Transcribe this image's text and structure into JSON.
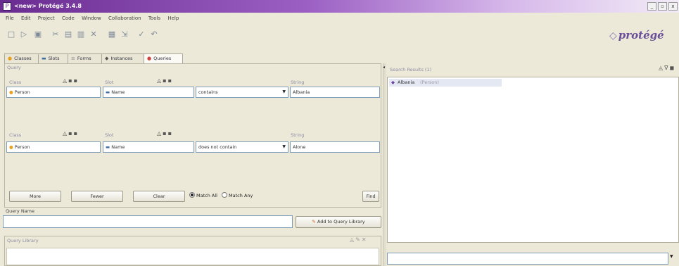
{
  "window": {
    "title": "<new> Protégé 3.4.8",
    "buttons": [
      "_",
      "▫",
      "x"
    ]
  },
  "menu": [
    "File",
    "Edit",
    "Project",
    "Code",
    "Window",
    "Collaboration",
    "Tools",
    "Help"
  ],
  "toolbar": {
    "icons": [
      "new-file-icon",
      "open-icon",
      "save-icon",
      "cut-icon",
      "copy-icon",
      "paste-icon",
      "delete-icon",
      "find-icon",
      "export-icon",
      "check-icon",
      "undo-icon"
    ]
  },
  "logo": {
    "text": "protégé"
  },
  "tabs": [
    {
      "label": "Classes",
      "icon": "●",
      "color": "#e8a020"
    },
    {
      "label": "Slots",
      "icon": "▬",
      "color": "#3a6ea5"
    },
    {
      "label": "Forms",
      "icon": "≡",
      "color": "#888888"
    },
    {
      "label": "Instances",
      "icon": "◆",
      "color": "#555555"
    },
    {
      "label": "Queries",
      "icon": "●",
      "color": "#d04040"
    }
  ],
  "query": {
    "header": "Query",
    "rows": [
      {
        "class_label": "Class",
        "slot_label": "Slot",
        "string_label": "String",
        "class_value": "Person",
        "slot_value": "Name",
        "operator": "contains",
        "string_value": "Albania"
      },
      {
        "class_label": "Class",
        "slot_label": "Slot",
        "string_label": "String",
        "class_value": "Person",
        "slot_value": "Name",
        "operator": "does not contain",
        "string_value": "Alone"
      }
    ],
    "buttons": {
      "more": "More",
      "fewer": "Fewer",
      "clear": "Clear",
      "find": "Find"
    },
    "match_all": "Match All",
    "match_any": "Match Any"
  },
  "query_name": {
    "label": "Query Name",
    "value": "",
    "add_button": "Add to Query Library"
  },
  "query_library": {
    "header": "Query Library"
  },
  "search_results": {
    "header": "Search Results (1)",
    "items": [
      {
        "label": "Albania",
        "type": "(Person)"
      }
    ]
  },
  "colors": {
    "title_bar": "#6a2c91",
    "selection": "#e4e8f3",
    "class_icon": "#e8a020",
    "slot_icon": "#3a6ea5"
  }
}
